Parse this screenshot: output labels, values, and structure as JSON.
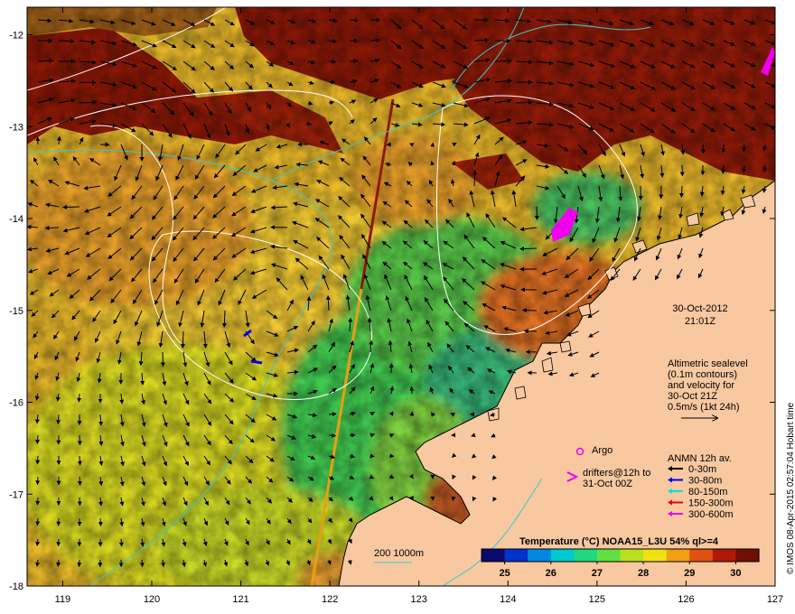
{
  "map": {
    "lon_range": [
      118.6,
      127
    ],
    "lat_range": [
      -18,
      -11.7
    ],
    "lon_ticks": [
      "119",
      "120",
      "121",
      "122",
      "123",
      "124",
      "125",
      "126",
      "127"
    ],
    "lat_ticks": [
      "-12",
      "-13",
      "-14",
      "-15",
      "-16",
      "-17",
      "-18"
    ]
  },
  "datetime": {
    "date": "30-Oct-2012",
    "time": "21:01Z"
  },
  "altimetry_note": {
    "line1": "Altimetric sealevel",
    "line2": "(0.1m contours)",
    "line3": "and velocity for",
    "line4": "30-Oct 21Z",
    "line5": "0.5m/s (1kt 24h)"
  },
  "argo": {
    "label": "Argo"
  },
  "drifters": {
    "line1": "drifters@12h to",
    "line2": "31-Oct 00Z"
  },
  "anmn": {
    "title": "ANMN 12h av.",
    "items": [
      {
        "label": "0-30m",
        "color": "#000000"
      },
      {
        "label": "30-80m",
        "color": "#0000ee"
      },
      {
        "label": "80-150m",
        "color": "#00e0e0"
      },
      {
        "label": "150-300m",
        "color": "#ee0000"
      },
      {
        "label": "300-600m",
        "color": "#ee00ee"
      }
    ]
  },
  "isobath": {
    "label": "200  1000m",
    "color": "#3cc8c8"
  },
  "colorbar": {
    "title": "Temperature (°C) NOAA15_L3U 54% ql>=4",
    "ticks": [
      "25",
      "26",
      "27",
      "28",
      "29",
      "30"
    ],
    "min": 24.5,
    "max": 30.5,
    "colors": [
      "#0a0a6e",
      "#0033cc",
      "#0088e0",
      "#00c8d0",
      "#20d880",
      "#60e040",
      "#b8e020",
      "#f0e010",
      "#f0a010",
      "#e05010",
      "#b01808",
      "#701004"
    ]
  },
  "credit": "© IMOS 08-Apr-2015 02:57:04 Hobart time"
}
